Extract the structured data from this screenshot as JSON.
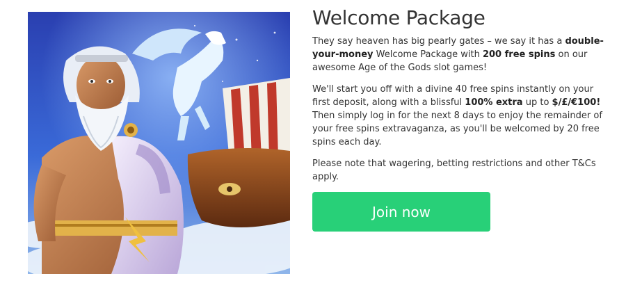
{
  "promo": {
    "title": "Welcome Package",
    "p1": {
      "t1": "They say heaven has big pearly gates – we say it has a ",
      "b1": "double-your-money",
      "t2": " Welcome Package with ",
      "b2": "200 free spins",
      "t3": " on our awesome Age of the Gods slot games!"
    },
    "p2": {
      "t1": "We'll start you off with a divine 40 free spins instantly on your first deposit, along with a blissful ",
      "b1": "100% extra",
      "t2": " up to ",
      "b2": "$/£/€100!",
      "t3": " Then simply log in for the next 8 days to enjoy the remainder of your free spins extravaganza, as you'll be welcomed by 20 free spins each day."
    },
    "p3": "Please note that wagering, betting restrictions and other T&Cs apply.",
    "cta_label": "Join now",
    "cta_color": "#28d078"
  },
  "hero_image": {
    "subject": "Zeus with white beard, winged pegasus and flying ship in the clouds"
  }
}
